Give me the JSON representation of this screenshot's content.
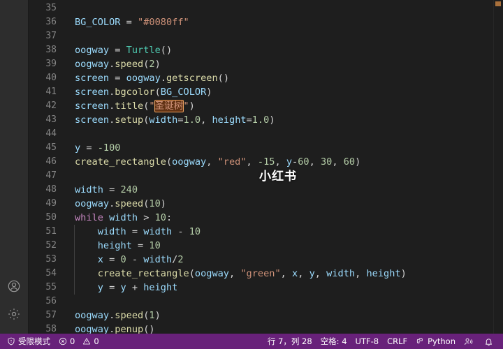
{
  "window": {
    "theme_bg": "#1e1e1e",
    "activitybar_bg": "#2d2d2d",
    "statusbar_bg": "#68217a"
  },
  "activity_bar": {
    "items": [
      {
        "name": "accounts",
        "icon": "account-icon",
        "label": "账户"
      },
      {
        "name": "settings",
        "icon": "gear-icon",
        "label": "管理"
      }
    ]
  },
  "editor": {
    "first_visible_line": 35,
    "watermark": "小红书",
    "find_match_text": "圣诞树",
    "lines": [
      {
        "n": 35,
        "tokens": []
      },
      {
        "n": 36,
        "tokens": [
          {
            "t": "BG_COLOR",
            "c": "t-var"
          },
          {
            "t": " = ",
            "c": "t-op"
          },
          {
            "t": "\"#0080ff\"",
            "c": "t-str"
          }
        ]
      },
      {
        "n": 37,
        "tokens": []
      },
      {
        "n": 38,
        "tokens": [
          {
            "t": "oogway",
            "c": "t-var"
          },
          {
            "t": " = ",
            "c": "t-op"
          },
          {
            "t": "Turtle",
            "c": "t-cls"
          },
          {
            "t": "()",
            "c": "t-punc"
          }
        ]
      },
      {
        "n": 39,
        "tokens": [
          {
            "t": "oogway",
            "c": "t-var"
          },
          {
            "t": ".",
            "c": "t-punc"
          },
          {
            "t": "speed",
            "c": "t-fn"
          },
          {
            "t": "(",
            "c": "t-punc"
          },
          {
            "t": "2",
            "c": "t-num"
          },
          {
            "t": ")",
            "c": "t-punc"
          }
        ]
      },
      {
        "n": 40,
        "tokens": [
          {
            "t": "screen",
            "c": "t-var"
          },
          {
            "t": " = ",
            "c": "t-op"
          },
          {
            "t": "oogway",
            "c": "t-var"
          },
          {
            "t": ".",
            "c": "t-punc"
          },
          {
            "t": "getscreen",
            "c": "t-fn"
          },
          {
            "t": "()",
            "c": "t-punc"
          }
        ]
      },
      {
        "n": 41,
        "tokens": [
          {
            "t": "screen",
            "c": "t-var"
          },
          {
            "t": ".",
            "c": "t-punc"
          },
          {
            "t": "bgcolor",
            "c": "t-fn"
          },
          {
            "t": "(",
            "c": "t-punc"
          },
          {
            "t": "BG_COLOR",
            "c": "t-var"
          },
          {
            "t": ")",
            "c": "t-punc"
          }
        ]
      },
      {
        "n": 42,
        "tokens": [
          {
            "t": "screen",
            "c": "t-var"
          },
          {
            "t": ".",
            "c": "t-punc"
          },
          {
            "t": "title",
            "c": "t-fn"
          },
          {
            "t": "(",
            "c": "t-punc"
          },
          {
            "t": "\"",
            "c": "t-str"
          },
          {
            "t": "圣诞树",
            "c": "t-str",
            "match": true
          },
          {
            "t": "\"",
            "c": "t-str"
          },
          {
            "t": ")",
            "c": "t-punc"
          }
        ]
      },
      {
        "n": 43,
        "tokens": [
          {
            "t": "screen",
            "c": "t-var"
          },
          {
            "t": ".",
            "c": "t-punc"
          },
          {
            "t": "setup",
            "c": "t-fn"
          },
          {
            "t": "(",
            "c": "t-punc"
          },
          {
            "t": "width",
            "c": "t-var"
          },
          {
            "t": "=",
            "c": "t-op"
          },
          {
            "t": "1.0",
            "c": "t-num"
          },
          {
            "t": ", ",
            "c": "t-punc"
          },
          {
            "t": "height",
            "c": "t-var"
          },
          {
            "t": "=",
            "c": "t-op"
          },
          {
            "t": "1.0",
            "c": "t-num"
          },
          {
            "t": ")",
            "c": "t-punc"
          }
        ]
      },
      {
        "n": 44,
        "tokens": []
      },
      {
        "n": 45,
        "tokens": [
          {
            "t": "y",
            "c": "t-var"
          },
          {
            "t": " = ",
            "c": "t-op"
          },
          {
            "t": "-100",
            "c": "t-num"
          }
        ]
      },
      {
        "n": 46,
        "tokens": [
          {
            "t": "create_rectangle",
            "c": "t-fn"
          },
          {
            "t": "(",
            "c": "t-punc"
          },
          {
            "t": "oogway",
            "c": "t-var"
          },
          {
            "t": ", ",
            "c": "t-punc"
          },
          {
            "t": "\"red\"",
            "c": "t-str"
          },
          {
            "t": ", ",
            "c": "t-punc"
          },
          {
            "t": "-15",
            "c": "t-num"
          },
          {
            "t": ", ",
            "c": "t-punc"
          },
          {
            "t": "y",
            "c": "t-var"
          },
          {
            "t": "-",
            "c": "t-op"
          },
          {
            "t": "60",
            "c": "t-num"
          },
          {
            "t": ", ",
            "c": "t-punc"
          },
          {
            "t": "30",
            "c": "t-num"
          },
          {
            "t": ", ",
            "c": "t-punc"
          },
          {
            "t": "60",
            "c": "t-num"
          },
          {
            "t": ")",
            "c": "t-punc"
          }
        ]
      },
      {
        "n": 47,
        "tokens": []
      },
      {
        "n": 48,
        "tokens": [
          {
            "t": "width",
            "c": "t-var"
          },
          {
            "t": " = ",
            "c": "t-op"
          },
          {
            "t": "240",
            "c": "t-num"
          }
        ]
      },
      {
        "n": 49,
        "tokens": [
          {
            "t": "oogway",
            "c": "t-var"
          },
          {
            "t": ".",
            "c": "t-punc"
          },
          {
            "t": "speed",
            "c": "t-fn"
          },
          {
            "t": "(",
            "c": "t-punc"
          },
          {
            "t": "10",
            "c": "t-num"
          },
          {
            "t": ")",
            "c": "t-punc"
          }
        ]
      },
      {
        "n": 50,
        "tokens": [
          {
            "t": "while",
            "c": "t-kw"
          },
          {
            "t": " ",
            "c": "t-plain"
          },
          {
            "t": "width",
            "c": "t-var"
          },
          {
            "t": " ",
            "c": "t-plain"
          },
          {
            "t": ">",
            "c": "t-op"
          },
          {
            "t": " ",
            "c": "t-plain"
          },
          {
            "t": "10",
            "c": "t-num"
          },
          {
            "t": ":",
            "c": "t-punc"
          }
        ]
      },
      {
        "n": 51,
        "indent": 1,
        "tokens": [
          {
            "t": "    ",
            "c": "t-plain"
          },
          {
            "t": "width",
            "c": "t-var"
          },
          {
            "t": " = ",
            "c": "t-op"
          },
          {
            "t": "width",
            "c": "t-var"
          },
          {
            "t": " ",
            "c": "t-plain"
          },
          {
            "t": "-",
            "c": "t-op"
          },
          {
            "t": " ",
            "c": "t-plain"
          },
          {
            "t": "10",
            "c": "t-num"
          }
        ]
      },
      {
        "n": 52,
        "indent": 1,
        "tokens": [
          {
            "t": "    ",
            "c": "t-plain"
          },
          {
            "t": "height",
            "c": "t-var"
          },
          {
            "t": " = ",
            "c": "t-op"
          },
          {
            "t": "10",
            "c": "t-num"
          }
        ]
      },
      {
        "n": 53,
        "indent": 1,
        "tokens": [
          {
            "t": "    ",
            "c": "t-plain"
          },
          {
            "t": "x",
            "c": "t-var"
          },
          {
            "t": " = ",
            "c": "t-op"
          },
          {
            "t": "0",
            "c": "t-num"
          },
          {
            "t": " ",
            "c": "t-plain"
          },
          {
            "t": "-",
            "c": "t-op"
          },
          {
            "t": " ",
            "c": "t-plain"
          },
          {
            "t": "width",
            "c": "t-var"
          },
          {
            "t": "/",
            "c": "t-op"
          },
          {
            "t": "2",
            "c": "t-num"
          }
        ]
      },
      {
        "n": 54,
        "indent": 1,
        "tokens": [
          {
            "t": "    ",
            "c": "t-plain"
          },
          {
            "t": "create_rectangle",
            "c": "t-fn"
          },
          {
            "t": "(",
            "c": "t-punc"
          },
          {
            "t": "oogway",
            "c": "t-var"
          },
          {
            "t": ", ",
            "c": "t-punc"
          },
          {
            "t": "\"green\"",
            "c": "t-str"
          },
          {
            "t": ", ",
            "c": "t-punc"
          },
          {
            "t": "x",
            "c": "t-var"
          },
          {
            "t": ", ",
            "c": "t-punc"
          },
          {
            "t": "y",
            "c": "t-var"
          },
          {
            "t": ", ",
            "c": "t-punc"
          },
          {
            "t": "width",
            "c": "t-var"
          },
          {
            "t": ", ",
            "c": "t-punc"
          },
          {
            "t": "height",
            "c": "t-var"
          },
          {
            "t": ")",
            "c": "t-punc"
          }
        ]
      },
      {
        "n": 55,
        "indent": 1,
        "tokens": [
          {
            "t": "    ",
            "c": "t-plain"
          },
          {
            "t": "y",
            "c": "t-var"
          },
          {
            "t": " = ",
            "c": "t-op"
          },
          {
            "t": "y",
            "c": "t-var"
          },
          {
            "t": " ",
            "c": "t-plain"
          },
          {
            "t": "+",
            "c": "t-op"
          },
          {
            "t": " ",
            "c": "t-plain"
          },
          {
            "t": "height",
            "c": "t-var"
          }
        ]
      },
      {
        "n": 56,
        "tokens": []
      },
      {
        "n": 57,
        "tokens": [
          {
            "t": "oogway",
            "c": "t-var"
          },
          {
            "t": ".",
            "c": "t-punc"
          },
          {
            "t": "speed",
            "c": "t-fn"
          },
          {
            "t": "(",
            "c": "t-punc"
          },
          {
            "t": "1",
            "c": "t-num"
          },
          {
            "t": ")",
            "c": "t-punc"
          }
        ]
      },
      {
        "n": 58,
        "tokens": [
          {
            "t": "oogway",
            "c": "t-var"
          },
          {
            "t": ".",
            "c": "t-punc"
          },
          {
            "t": "penup",
            "c": "t-fn"
          },
          {
            "t": "()",
            "c": "t-punc"
          }
        ]
      }
    ]
  },
  "status_bar": {
    "restricted_mode": "受限模式",
    "errors": "0",
    "warnings": "0",
    "cursor_position": "行 7，列 28",
    "indentation": "空格: 4",
    "encoding": "UTF-8",
    "eol": "CRLF",
    "language": "Python",
    "feedback_label": "",
    "notifications_label": ""
  }
}
